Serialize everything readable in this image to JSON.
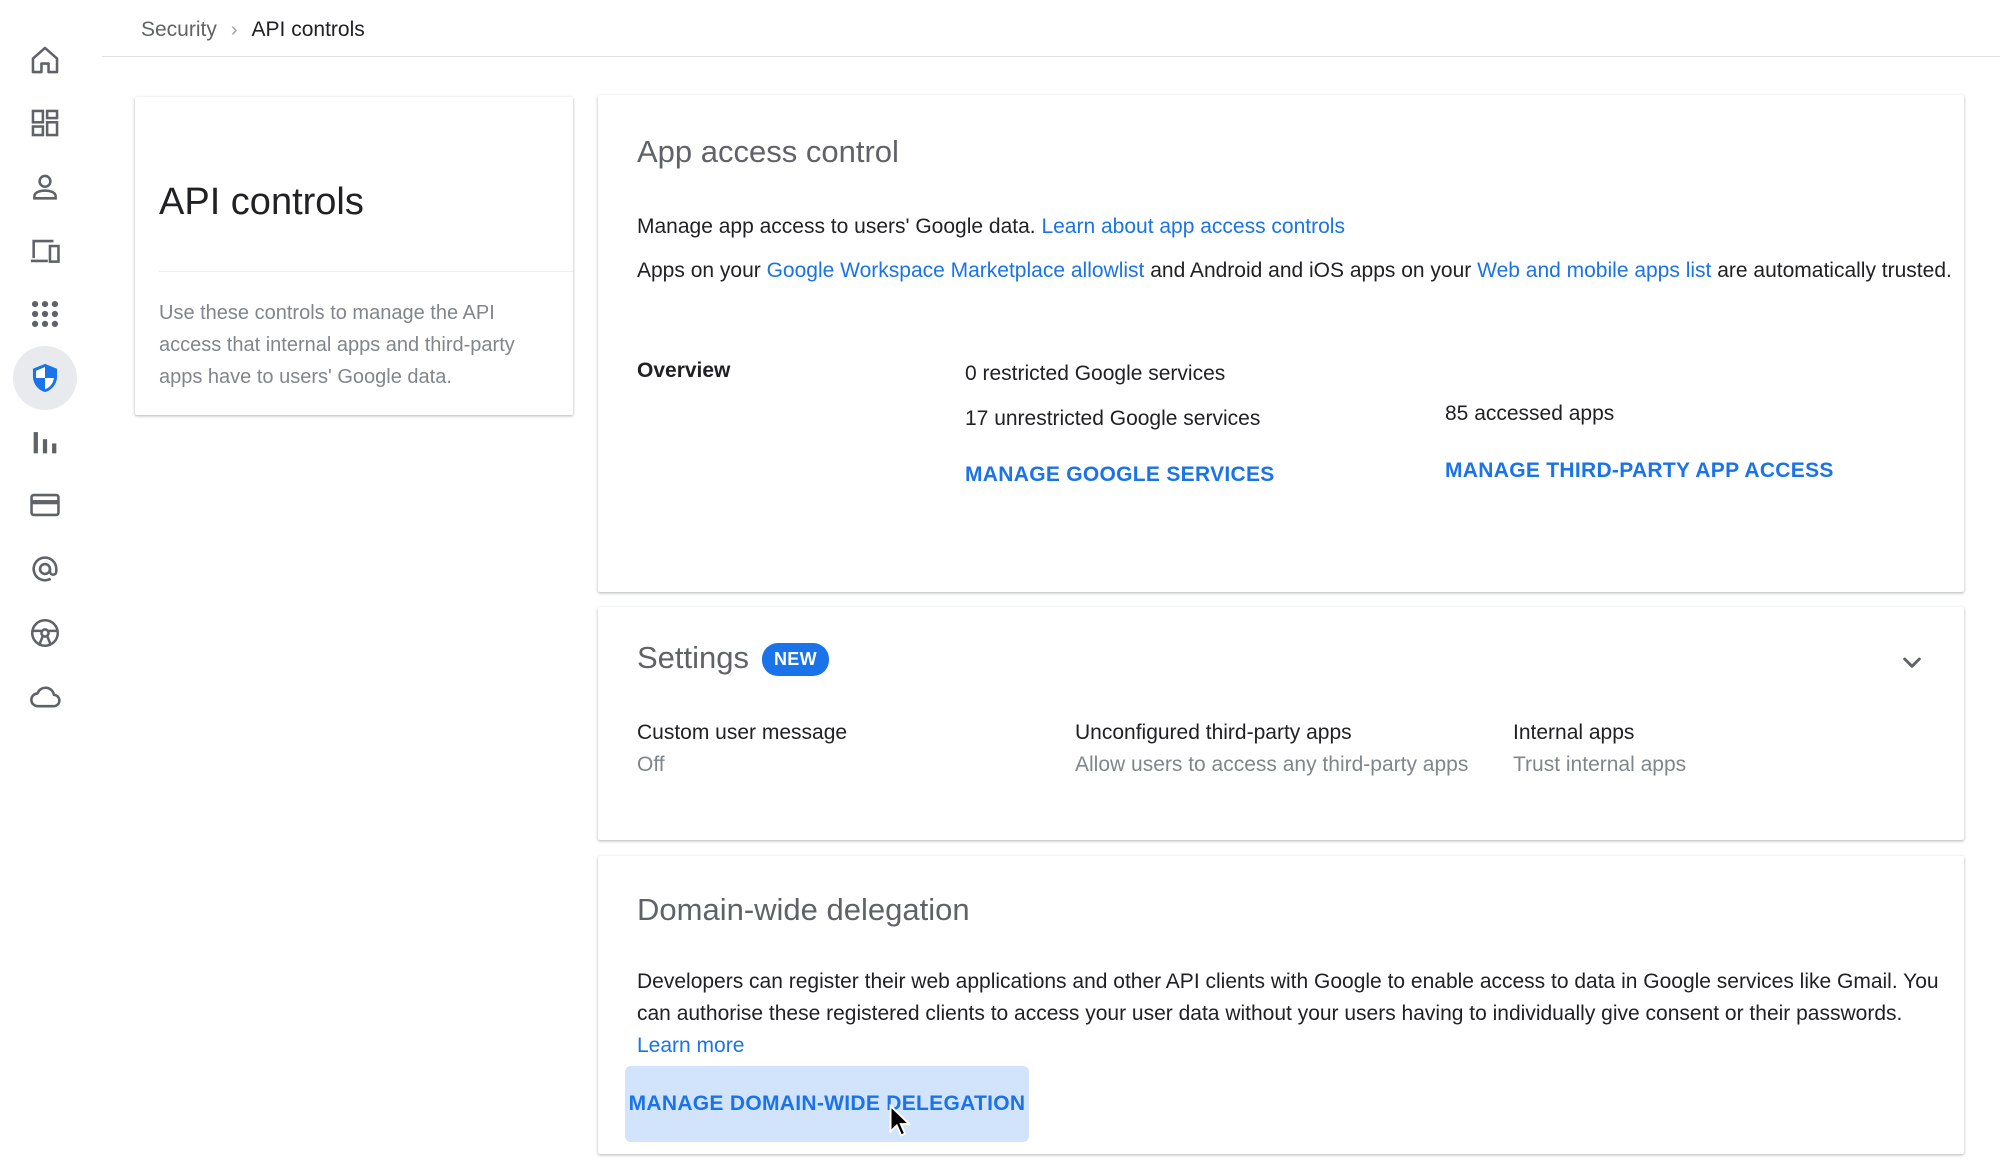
{
  "breadcrumb": {
    "parent": "Security",
    "separator": "›",
    "current": "API controls"
  },
  "rail": {
    "items": [
      {
        "icon": "home-icon"
      },
      {
        "icon": "dashboard-icon"
      },
      {
        "icon": "user-icon"
      },
      {
        "icon": "devices-icon"
      },
      {
        "icon": "apps-grid-icon"
      },
      {
        "icon": "security-shield-icon",
        "active": true
      },
      {
        "icon": "reports-icon"
      },
      {
        "icon": "billing-icon"
      },
      {
        "icon": "account-at-icon"
      },
      {
        "icon": "rules-icon"
      },
      {
        "icon": "cloud-icon"
      }
    ]
  },
  "info_card": {
    "title": "API controls",
    "description": "Use these controls to manage the API access that internal apps and third-party apps have to users' Google data."
  },
  "app_access": {
    "title": "App access control",
    "line1_text": "Manage app access to users' Google data.",
    "line1_link": "Learn about app access controls",
    "line2_a": "Apps on your",
    "line2_link1": "Google Workspace Marketplace allowlist",
    "line2_b": "and Android and iOS apps on your",
    "line2_link2": "Web and mobile apps list",
    "line2_c": "are automatically trusted.",
    "overview_label": "Overview",
    "restricted": "0 restricted Google services",
    "unrestricted": "17 unrestricted Google services",
    "accessed_apps": "85 accessed apps",
    "manage_services": "MANAGE GOOGLE SERVICES",
    "manage_third_party": "MANAGE THIRD-PARTY APP ACCESS"
  },
  "settings": {
    "title": "Settings",
    "badge": "NEW",
    "items": [
      {
        "label": "Custom user message",
        "value": "Off"
      },
      {
        "label": "Unconfigured third-party apps",
        "value": "Allow users to access any third-party apps"
      },
      {
        "label": "Internal apps",
        "value": "Trust internal apps"
      }
    ]
  },
  "delegation": {
    "title": "Domain-wide delegation",
    "text": "Developers can register their web applications and other API clients with Google to enable access to data in Google services like Gmail. You can authorise these registered clients to access your user data without your users having to individually give consent or their passwords.",
    "link": "Learn more",
    "button": "MANAGE DOMAIN-WIDE DELEGATION"
  },
  "colors": {
    "link": "#1a73e8",
    "badge_bg": "#1a73e8",
    "button_highlight": "#d2e3fc",
    "secondary_text": "#80868b"
  }
}
